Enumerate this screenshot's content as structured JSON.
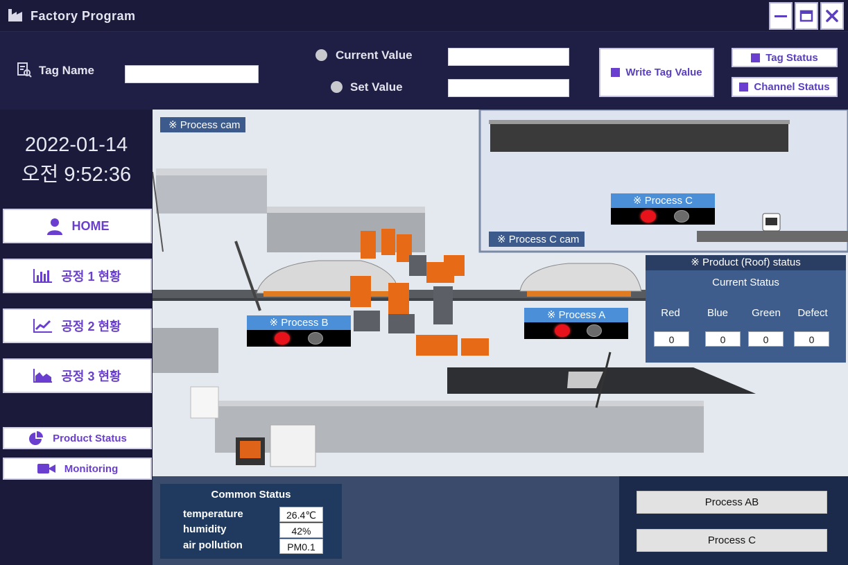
{
  "window": {
    "title": "Factory Program",
    "minimize_icon": "minimize-icon",
    "maximize_icon": "maximize-icon",
    "close_icon": "close-icon"
  },
  "toolbar": {
    "tag_name_label": "Tag Name",
    "tag_name_value": "",
    "current_value_label": "Current Value",
    "current_value": "",
    "set_value_label": "Set Value",
    "set_value": "",
    "write_button": "Write Tag Value",
    "tag_status_button": "Tag Status",
    "channel_status_button": "Channel Status"
  },
  "sidebar": {
    "date": "2022-01-14",
    "time": "오전  9:52:36",
    "items": [
      {
        "label": "HOME",
        "icon": "user-icon"
      },
      {
        "label": "공정 1 현황",
        "icon": "bar-chart-icon"
      },
      {
        "label": "공정 2 현황",
        "icon": "line-chart-icon"
      },
      {
        "label": "공정 3 현황",
        "icon": "area-chart-icon"
      },
      {
        "label": "Product Status",
        "icon": "pie-chart-icon"
      },
      {
        "label": "Monitoring",
        "icon": "video-camera-icon"
      }
    ]
  },
  "scene": {
    "process_cam": "※ Process cam",
    "process_c_cam": "※ Process C cam",
    "process_a": "※ Process A",
    "process_b": "※ Process B",
    "process_c": "※ Process C",
    "lamp_colors": {
      "red": "#e8131a",
      "off": "#6b6b6b"
    }
  },
  "roof_status": {
    "title": "※ Product (Roof) status",
    "current_status": "Current Status",
    "columns": [
      {
        "label": "Red",
        "value": "0"
      },
      {
        "label": "Blue",
        "value": "0"
      },
      {
        "label": "Green",
        "value": "0"
      },
      {
        "label": "Defect",
        "value": "0"
      }
    ]
  },
  "common_status": {
    "title": "Common Status",
    "rows": [
      {
        "label": "temperature",
        "value": "26.4℃"
      },
      {
        "label": "humidity",
        "value": "42%"
      },
      {
        "label": "air pollution",
        "value": "PM0.1"
      }
    ]
  },
  "process_buttons": {
    "ab": "Process AB",
    "c": "Process C"
  },
  "colors": {
    "background": "#1b1a3a",
    "accent": "#6a3fd0",
    "panel_blue": "#3f5d8c",
    "label_blue": "#4a8fd8"
  }
}
